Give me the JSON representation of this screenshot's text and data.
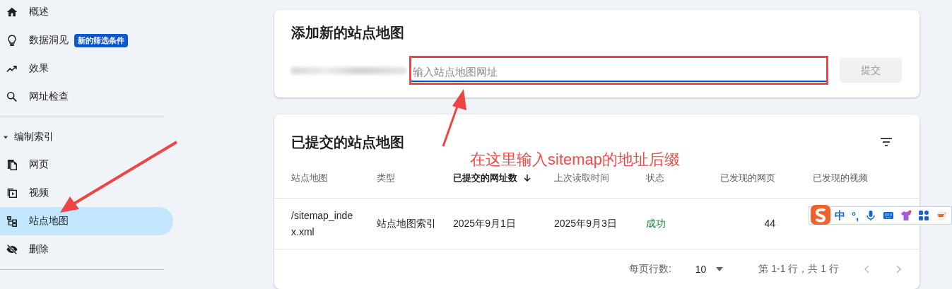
{
  "sidebar": {
    "groups": [
      {
        "items": [
          {
            "label": "概述",
            "selected": false
          },
          {
            "label": "数据洞见",
            "badge": "新的筛选条件",
            "selected": false
          },
          {
            "label": "效果",
            "selected": false
          },
          {
            "label": "网址检查",
            "selected": false
          }
        ]
      },
      {
        "title": "编制索引",
        "expanded": true,
        "items": [
          {
            "label": "网页",
            "selected": false
          },
          {
            "label": "视频",
            "selected": false
          },
          {
            "label": "站点地图",
            "selected": true
          },
          {
            "label": "删除",
            "selected": false
          }
        ]
      }
    ]
  },
  "add_sitemap": {
    "title": "添加新的站点地图",
    "placeholder": "输入站点地图网址",
    "submit": {
      "label": "提交",
      "disabled": true
    }
  },
  "submitted_sitemaps": {
    "title": "已提交的站点地图",
    "columns": [
      {
        "label": "站点地图",
        "sorted": false
      },
      {
        "label": "类型",
        "sorted": false
      },
      {
        "label": "已提交的网址数",
        "sorted": true
      },
      {
        "label": "上次读取时间",
        "sorted": false
      },
      {
        "label": "状态",
        "sorted": false
      },
      {
        "label": "已发现的网页",
        "sorted": false
      },
      {
        "label": "已发现的视频",
        "sorted": false
      }
    ],
    "rows": [
      {
        "sitemap": "/sitemap_index.xml",
        "type": "站点地图索引",
        "submitted": "2025年9月1日",
        "last_read": "2025年9月3日",
        "status": "成功",
        "succeeded": true,
        "pages": "44"
      }
    ],
    "footer": {
      "rows_per_page_label": "每页行数:",
      "rows_per_page": "10",
      "range": "第 1-1 行，共 1 行",
      "prev_disabled": true,
      "next_disabled": true
    }
  },
  "ime_toolbar": {
    "mode": "中",
    "punctuation": "°,"
  },
  "annotation": {
    "note": "在这里输入sitemap的地址后缀"
  }
}
